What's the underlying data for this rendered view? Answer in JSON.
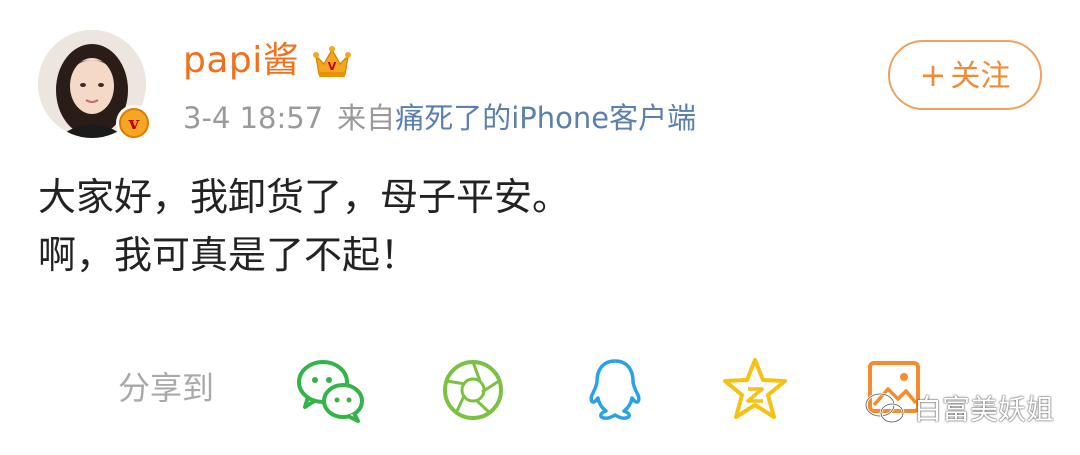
{
  "post": {
    "username": "papi酱",
    "time": "3-4 18:57",
    "source_prefix": "来自",
    "source_link": "痛死了的iPhone客户端",
    "content_lines": [
      "大家好，我卸货了，母子平安。",
      "啊，我可真是了不起！"
    ]
  },
  "follow": {
    "plus": "+",
    "label": "关注"
  },
  "share": {
    "label": "分享到",
    "icons": [
      "wechat-icon",
      "moments-icon",
      "qq-icon",
      "qzone-icon",
      "album-icon"
    ]
  },
  "watermark": {
    "text": "白富美妖姐"
  },
  "colors": {
    "username": "#f36f1e",
    "source_link": "#5b7fae",
    "follow_border": "#f2a05d",
    "wechat": "#34b34a",
    "moments": "#7bc142",
    "qq": "#2aa2e6",
    "qzone": "#f5c113",
    "album": "#f58b2a"
  }
}
